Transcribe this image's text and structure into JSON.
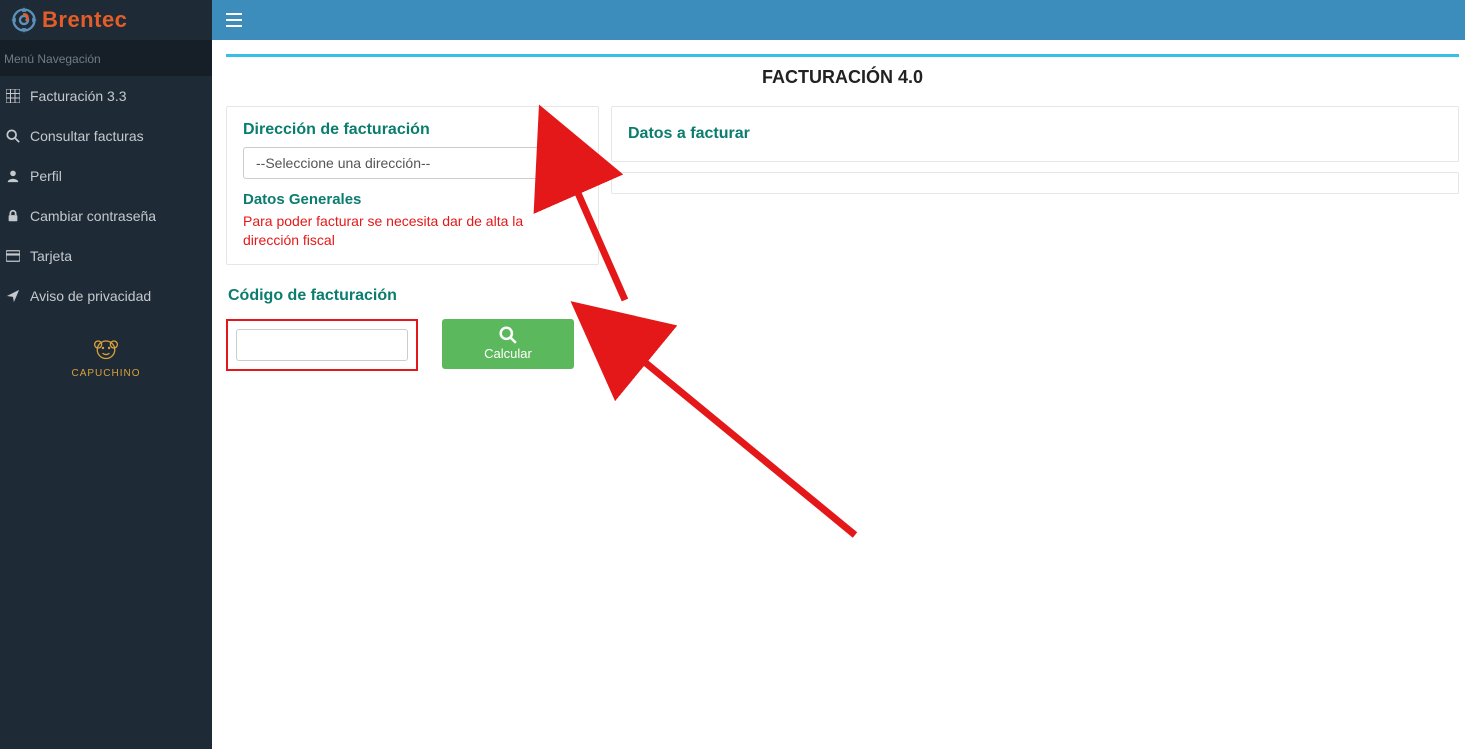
{
  "brand": {
    "name": "Brentec"
  },
  "sidebar": {
    "menu_header": "Menú Navegación",
    "items": [
      {
        "label": "Facturación 3.3"
      },
      {
        "label": "Consultar facturas"
      },
      {
        "label": "Perfil"
      },
      {
        "label": "Cambiar contraseña"
      },
      {
        "label": "Tarjeta"
      },
      {
        "label": "Aviso de privacidad"
      }
    ],
    "capuchino_label": "CAPUCHINO"
  },
  "page": {
    "title": "FACTURACIÓN 4.0",
    "direccion_title": "Dirección de facturación",
    "direccion_placeholder": "--Seleccione una dirección--",
    "datos_generales_title": "Datos Generales",
    "datos_generales_warning": "Para poder facturar se necesita dar de alta la dirección fiscal",
    "codigo_title": "Código de facturación",
    "codigo_value": "",
    "calcular_label": "Calcular",
    "datos_facturar_title": "Datos a facturar"
  }
}
